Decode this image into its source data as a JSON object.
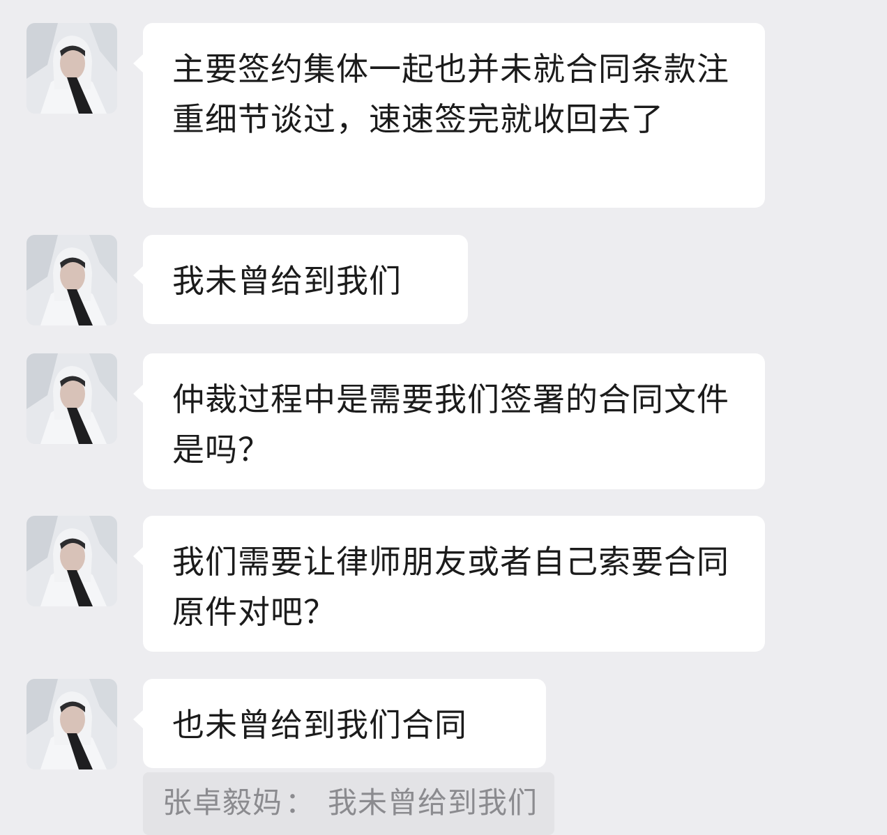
{
  "messages": [
    {
      "text": "主要签约集体一起也并未就合同条款注重细节谈过，速速签完就收回去了"
    },
    {
      "text": "我未曾给到我们"
    },
    {
      "text": "仲裁过程中是需要我们签署的合同文件是吗？"
    },
    {
      "text": "我们需要让律师朋友或者自己索要合同原件对吧？"
    },
    {
      "text": "也未曾给到我们合同"
    }
  ],
  "quote": {
    "sender": "张卓毅妈",
    "separator": "：",
    "text": "我未曾给到我们"
  },
  "colors": {
    "background": "#ededf0",
    "bubble": "#ffffff",
    "quote_background": "#e3e3e6",
    "quote_text": "#8b8b8f"
  }
}
